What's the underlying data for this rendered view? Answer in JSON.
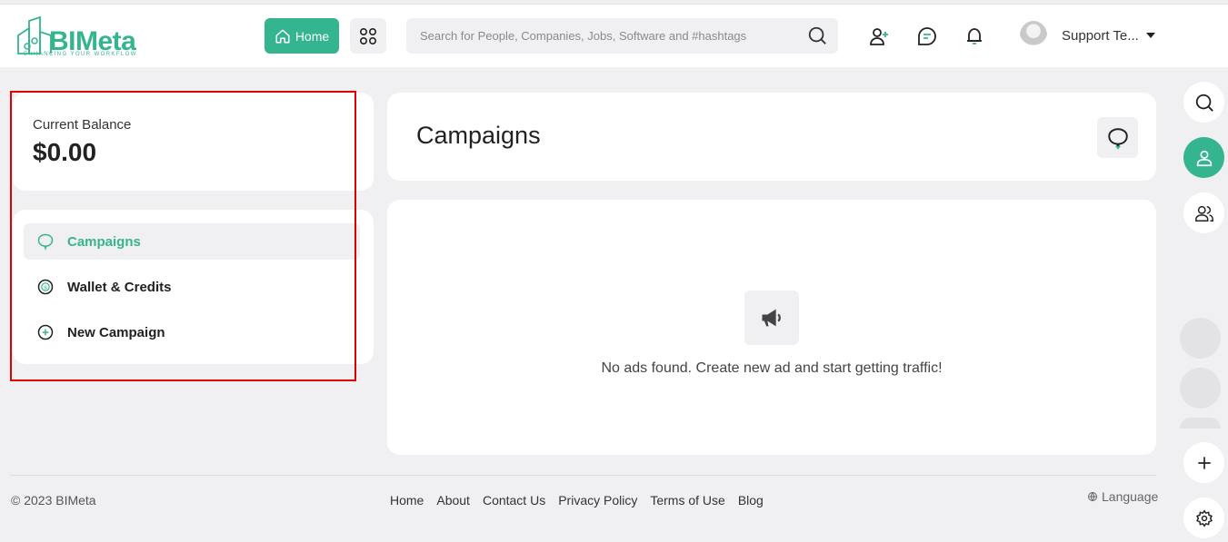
{
  "brand": {
    "name": "BIMeta",
    "tagline": "ENHANCING YOUR WORKFLOW",
    "accent_color": "#35b58f"
  },
  "header": {
    "home_label": "Home",
    "search_placeholder": "Search for People, Companies, Jobs, Software and #hashtags",
    "user_name": "Support Te..."
  },
  "sidebar": {
    "balance_label": "Current Balance",
    "balance_value": "$0.00",
    "items": [
      {
        "label": "Campaigns",
        "icon": "campaign-icon",
        "active": true
      },
      {
        "label": "Wallet & Credits",
        "icon": "wallet-icon",
        "active": false
      },
      {
        "label": "New Campaign",
        "icon": "plus-circle-icon",
        "active": false
      }
    ]
  },
  "main": {
    "title": "Campaigns",
    "empty_message": "No ads found. Create new ad and start getting traffic!"
  },
  "footer": {
    "copyright": "© 2023 BIMeta",
    "links": [
      "Home",
      "About",
      "Contact Us",
      "Privacy Policy",
      "Terms of Use",
      "Blog"
    ],
    "language": "Language"
  },
  "right_rail": {
    "icons": [
      "search-icon",
      "person-icon",
      "people-icon",
      "plus-icon",
      "settings-icon"
    ]
  }
}
